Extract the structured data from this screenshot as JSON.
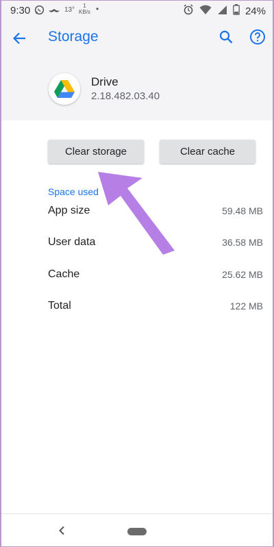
{
  "status_bar": {
    "time": "9:30",
    "temperature": "13°",
    "speed_value": "1",
    "speed_unit": "KB/s",
    "dot": "•",
    "battery": "24%"
  },
  "toolbar": {
    "title": "Storage"
  },
  "app": {
    "name": "Drive",
    "version": "2.18.482.03.40"
  },
  "buttons": {
    "clear_storage": "Clear storage",
    "clear_cache": "Clear cache"
  },
  "space_used": {
    "title": "Space used",
    "rows": [
      {
        "label": "App size",
        "value": "59.48 MB"
      },
      {
        "label": "User data",
        "value": "36.58 MB"
      },
      {
        "label": "Cache",
        "value": "25.62 MB"
      },
      {
        "label": "Total",
        "value": "122 MB"
      }
    ]
  },
  "colors": {
    "accent": "#1a73e8",
    "annotation_arrow": "#b57fe6",
    "button_bg": "#dfe1e3"
  }
}
